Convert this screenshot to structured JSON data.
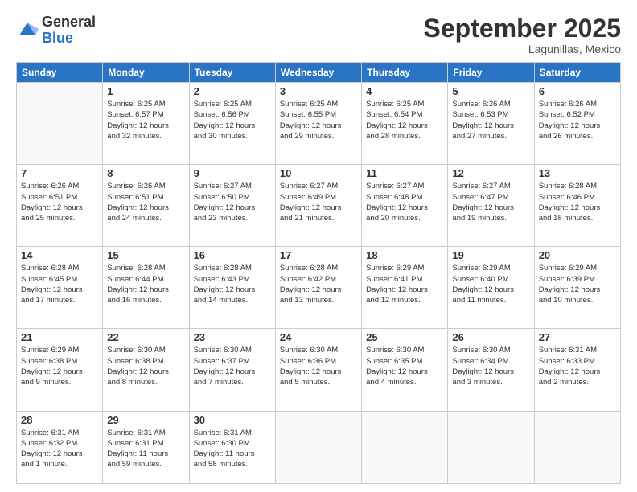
{
  "logo": {
    "general": "General",
    "blue": "Blue"
  },
  "header": {
    "title": "September 2025",
    "location": "Lagunillas, Mexico"
  },
  "weekdays": [
    "Sunday",
    "Monday",
    "Tuesday",
    "Wednesday",
    "Thursday",
    "Friday",
    "Saturday"
  ],
  "weeks": [
    [
      {
        "day": "",
        "info": ""
      },
      {
        "day": "1",
        "info": "Sunrise: 6:25 AM\nSunset: 6:57 PM\nDaylight: 12 hours\nand 32 minutes."
      },
      {
        "day": "2",
        "info": "Sunrise: 6:25 AM\nSunset: 6:56 PM\nDaylight: 12 hours\nand 30 minutes."
      },
      {
        "day": "3",
        "info": "Sunrise: 6:25 AM\nSunset: 6:55 PM\nDaylight: 12 hours\nand 29 minutes."
      },
      {
        "day": "4",
        "info": "Sunrise: 6:25 AM\nSunset: 6:54 PM\nDaylight: 12 hours\nand 28 minutes."
      },
      {
        "day": "5",
        "info": "Sunrise: 6:26 AM\nSunset: 6:53 PM\nDaylight: 12 hours\nand 27 minutes."
      },
      {
        "day": "6",
        "info": "Sunrise: 6:26 AM\nSunset: 6:52 PM\nDaylight: 12 hours\nand 26 minutes."
      }
    ],
    [
      {
        "day": "7",
        "info": "Sunrise: 6:26 AM\nSunset: 6:51 PM\nDaylight: 12 hours\nand 25 minutes."
      },
      {
        "day": "8",
        "info": "Sunrise: 6:26 AM\nSunset: 6:51 PM\nDaylight: 12 hours\nand 24 minutes."
      },
      {
        "day": "9",
        "info": "Sunrise: 6:27 AM\nSunset: 6:50 PM\nDaylight: 12 hours\nand 23 minutes."
      },
      {
        "day": "10",
        "info": "Sunrise: 6:27 AM\nSunset: 6:49 PM\nDaylight: 12 hours\nand 21 minutes."
      },
      {
        "day": "11",
        "info": "Sunrise: 6:27 AM\nSunset: 6:48 PM\nDaylight: 12 hours\nand 20 minutes."
      },
      {
        "day": "12",
        "info": "Sunrise: 6:27 AM\nSunset: 6:47 PM\nDaylight: 12 hours\nand 19 minutes."
      },
      {
        "day": "13",
        "info": "Sunrise: 6:28 AM\nSunset: 6:46 PM\nDaylight: 12 hours\nand 18 minutes."
      }
    ],
    [
      {
        "day": "14",
        "info": "Sunrise: 6:28 AM\nSunset: 6:45 PM\nDaylight: 12 hours\nand 17 minutes."
      },
      {
        "day": "15",
        "info": "Sunrise: 6:28 AM\nSunset: 6:44 PM\nDaylight: 12 hours\nand 16 minutes."
      },
      {
        "day": "16",
        "info": "Sunrise: 6:28 AM\nSunset: 6:43 PM\nDaylight: 12 hours\nand 14 minutes."
      },
      {
        "day": "17",
        "info": "Sunrise: 6:28 AM\nSunset: 6:42 PM\nDaylight: 12 hours\nand 13 minutes."
      },
      {
        "day": "18",
        "info": "Sunrise: 6:29 AM\nSunset: 6:41 PM\nDaylight: 12 hours\nand 12 minutes."
      },
      {
        "day": "19",
        "info": "Sunrise: 6:29 AM\nSunset: 6:40 PM\nDaylight: 12 hours\nand 11 minutes."
      },
      {
        "day": "20",
        "info": "Sunrise: 6:29 AM\nSunset: 6:39 PM\nDaylight: 12 hours\nand 10 minutes."
      }
    ],
    [
      {
        "day": "21",
        "info": "Sunrise: 6:29 AM\nSunset: 6:38 PM\nDaylight: 12 hours\nand 9 minutes."
      },
      {
        "day": "22",
        "info": "Sunrise: 6:30 AM\nSunset: 6:38 PM\nDaylight: 12 hours\nand 8 minutes."
      },
      {
        "day": "23",
        "info": "Sunrise: 6:30 AM\nSunset: 6:37 PM\nDaylight: 12 hours\nand 7 minutes."
      },
      {
        "day": "24",
        "info": "Sunrise: 6:30 AM\nSunset: 6:36 PM\nDaylight: 12 hours\nand 5 minutes."
      },
      {
        "day": "25",
        "info": "Sunrise: 6:30 AM\nSunset: 6:35 PM\nDaylight: 12 hours\nand 4 minutes."
      },
      {
        "day": "26",
        "info": "Sunrise: 6:30 AM\nSunset: 6:34 PM\nDaylight: 12 hours\nand 3 minutes."
      },
      {
        "day": "27",
        "info": "Sunrise: 6:31 AM\nSunset: 6:33 PM\nDaylight: 12 hours\nand 2 minutes."
      }
    ],
    [
      {
        "day": "28",
        "info": "Sunrise: 6:31 AM\nSunset: 6:32 PM\nDaylight: 12 hours\nand 1 minute."
      },
      {
        "day": "29",
        "info": "Sunrise: 6:31 AM\nSunset: 6:31 PM\nDaylight: 11 hours\nand 59 minutes."
      },
      {
        "day": "30",
        "info": "Sunrise: 6:31 AM\nSunset: 6:30 PM\nDaylight: 11 hours\nand 58 minutes."
      },
      {
        "day": "",
        "info": ""
      },
      {
        "day": "",
        "info": ""
      },
      {
        "day": "",
        "info": ""
      },
      {
        "day": "",
        "info": ""
      }
    ]
  ]
}
